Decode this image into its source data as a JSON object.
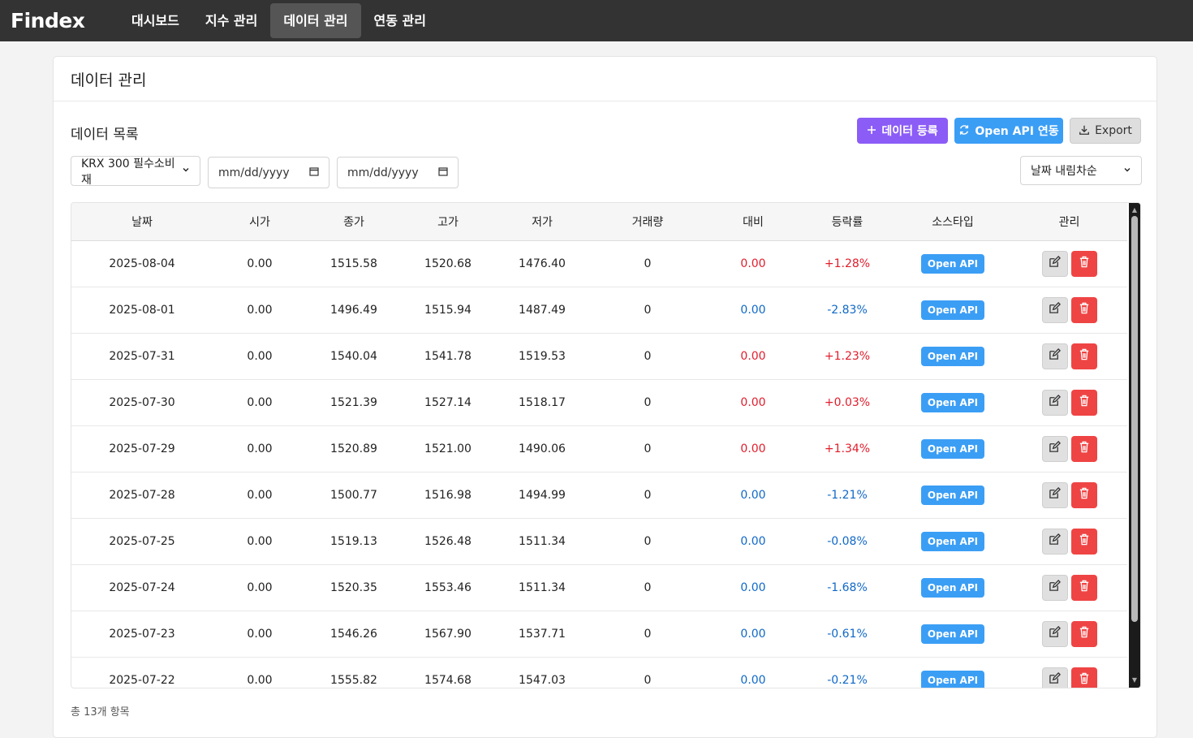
{
  "brand": "Findex",
  "nav": [
    {
      "label": "대시보드",
      "active": false
    },
    {
      "label": "지수 관리",
      "active": false
    },
    {
      "label": "데이터 관리",
      "active": true
    },
    {
      "label": "연동 관리",
      "active": false
    }
  ],
  "page": {
    "title": "데이터 관리",
    "section_title": "데이터 목록",
    "buttons": {
      "add": "데이터 등록",
      "sync": "Open API 연동",
      "export": "Export"
    },
    "filters": {
      "index_select": "KRX 300 필수소비재",
      "date_from_placeholder": "mm/dd/yyyy",
      "date_to_placeholder": "mm/dd/yyyy",
      "sort_select": "날짜 내림차순"
    },
    "footer": "총 13개 항목"
  },
  "table": {
    "columns": [
      "날짜",
      "시가",
      "종가",
      "고가",
      "저가",
      "거래량",
      "대비",
      "등락률",
      "소스타입",
      "관리"
    ],
    "rows": [
      {
        "date": "2025-08-04",
        "open": "0.00",
        "close": "1515.58",
        "high": "1520.68",
        "low": "1476.40",
        "volume": "0",
        "change": "0.00",
        "rate": "+1.28%",
        "dir": "up",
        "source": "Open API"
      },
      {
        "date": "2025-08-01",
        "open": "0.00",
        "close": "1496.49",
        "high": "1515.94",
        "low": "1487.49",
        "volume": "0",
        "change": "0.00",
        "rate": "-2.83%",
        "dir": "down",
        "source": "Open API"
      },
      {
        "date": "2025-07-31",
        "open": "0.00",
        "close": "1540.04",
        "high": "1541.78",
        "low": "1519.53",
        "volume": "0",
        "change": "0.00",
        "rate": "+1.23%",
        "dir": "up",
        "source": "Open API"
      },
      {
        "date": "2025-07-30",
        "open": "0.00",
        "close": "1521.39",
        "high": "1527.14",
        "low": "1518.17",
        "volume": "0",
        "change": "0.00",
        "rate": "+0.03%",
        "dir": "up",
        "source": "Open API"
      },
      {
        "date": "2025-07-29",
        "open": "0.00",
        "close": "1520.89",
        "high": "1521.00",
        "low": "1490.06",
        "volume": "0",
        "change": "0.00",
        "rate": "+1.34%",
        "dir": "up",
        "source": "Open API"
      },
      {
        "date": "2025-07-28",
        "open": "0.00",
        "close": "1500.77",
        "high": "1516.98",
        "low": "1494.99",
        "volume": "0",
        "change": "0.00",
        "rate": "-1.21%",
        "dir": "down",
        "source": "Open API"
      },
      {
        "date": "2025-07-25",
        "open": "0.00",
        "close": "1519.13",
        "high": "1526.48",
        "low": "1511.34",
        "volume": "0",
        "change": "0.00",
        "rate": "-0.08%",
        "dir": "down",
        "source": "Open API"
      },
      {
        "date": "2025-07-24",
        "open": "0.00",
        "close": "1520.35",
        "high": "1553.46",
        "low": "1511.34",
        "volume": "0",
        "change": "0.00",
        "rate": "-1.68%",
        "dir": "down",
        "source": "Open API"
      },
      {
        "date": "2025-07-23",
        "open": "0.00",
        "close": "1546.26",
        "high": "1567.90",
        "low": "1537.71",
        "volume": "0",
        "change": "0.00",
        "rate": "-0.61%",
        "dir": "down",
        "source": "Open API"
      },
      {
        "date": "2025-07-22",
        "open": "0.00",
        "close": "1555.82",
        "high": "1574.68",
        "low": "1547.03",
        "volume": "0",
        "change": "0.00",
        "rate": "-0.21%",
        "dir": "down",
        "source": "Open API"
      }
    ]
  },
  "colors": {
    "up": "#e11d2c",
    "down": "#1068c7",
    "primary": "#8b5cf6",
    "api": "#3b9ef5",
    "danger": "#ef4444"
  }
}
